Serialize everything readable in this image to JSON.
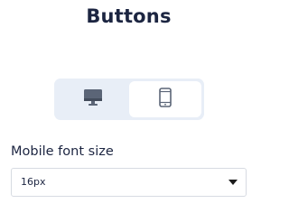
{
  "panel": {
    "title": "Buttons"
  },
  "device_toggle": {
    "options": [
      {
        "icon": "desktop-monitor-icon",
        "selected": false
      },
      {
        "icon": "mobile-phone-icon",
        "selected": true
      }
    ]
  },
  "font_size": {
    "label": "Mobile font size",
    "value": "16px"
  },
  "colors": {
    "text": "#1c2541",
    "toggle_bg": "#e8eef7",
    "icon": "#5b6577"
  }
}
